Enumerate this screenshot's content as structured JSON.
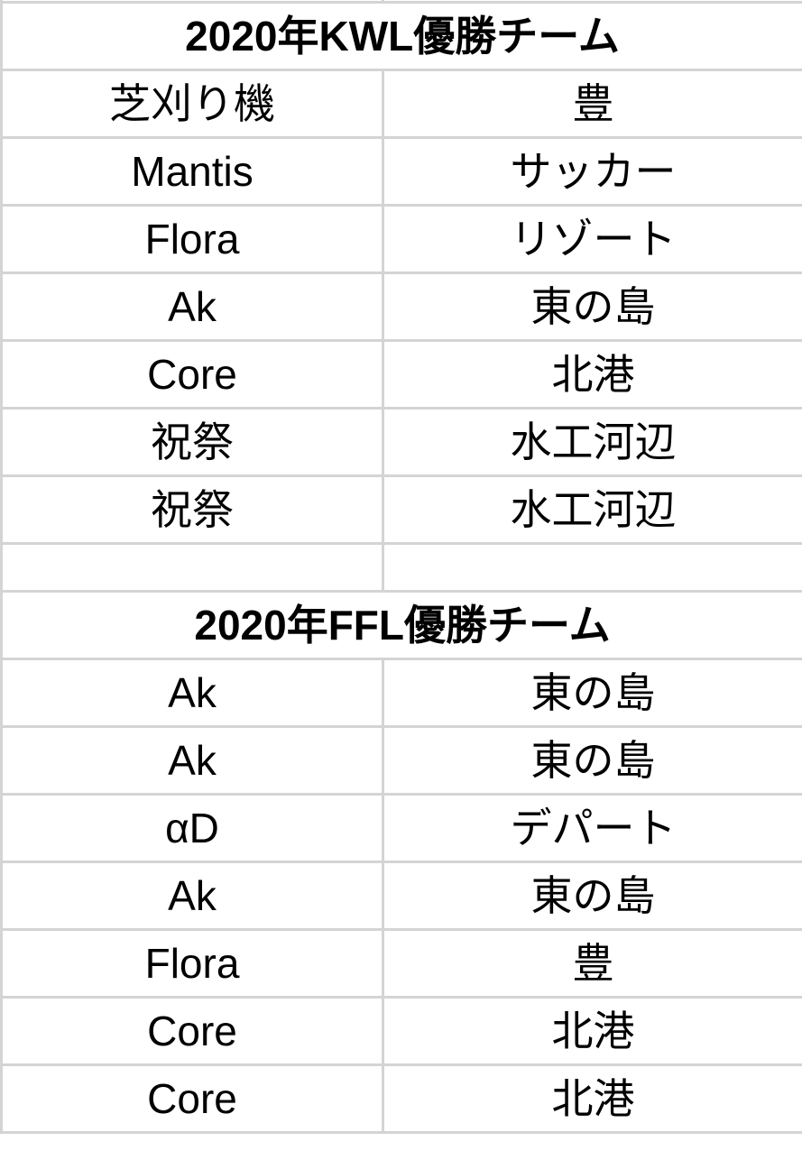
{
  "sections": [
    {
      "title": "2020年KWL優勝チーム",
      "rows": [
        [
          "芝刈り機",
          "豊"
        ],
        [
          "Mantis",
          "サッカー"
        ],
        [
          "Flora",
          "リゾート"
        ],
        [
          "Ak",
          "東の島"
        ],
        [
          "Core",
          "北港"
        ],
        [
          "祝祭",
          "水工河辺"
        ],
        [
          "祝祭",
          "水工河辺"
        ]
      ]
    },
    {
      "title": "2020年FFL優勝チーム",
      "rows": [
        [
          "Ak",
          "東の島"
        ],
        [
          "Ak",
          "東の島"
        ],
        [
          "αD",
          "デパート"
        ],
        [
          "Ak",
          "東の島"
        ],
        [
          "Flora",
          "豊"
        ],
        [
          "Core",
          "北港"
        ],
        [
          "Core",
          "北港"
        ]
      ]
    }
  ]
}
